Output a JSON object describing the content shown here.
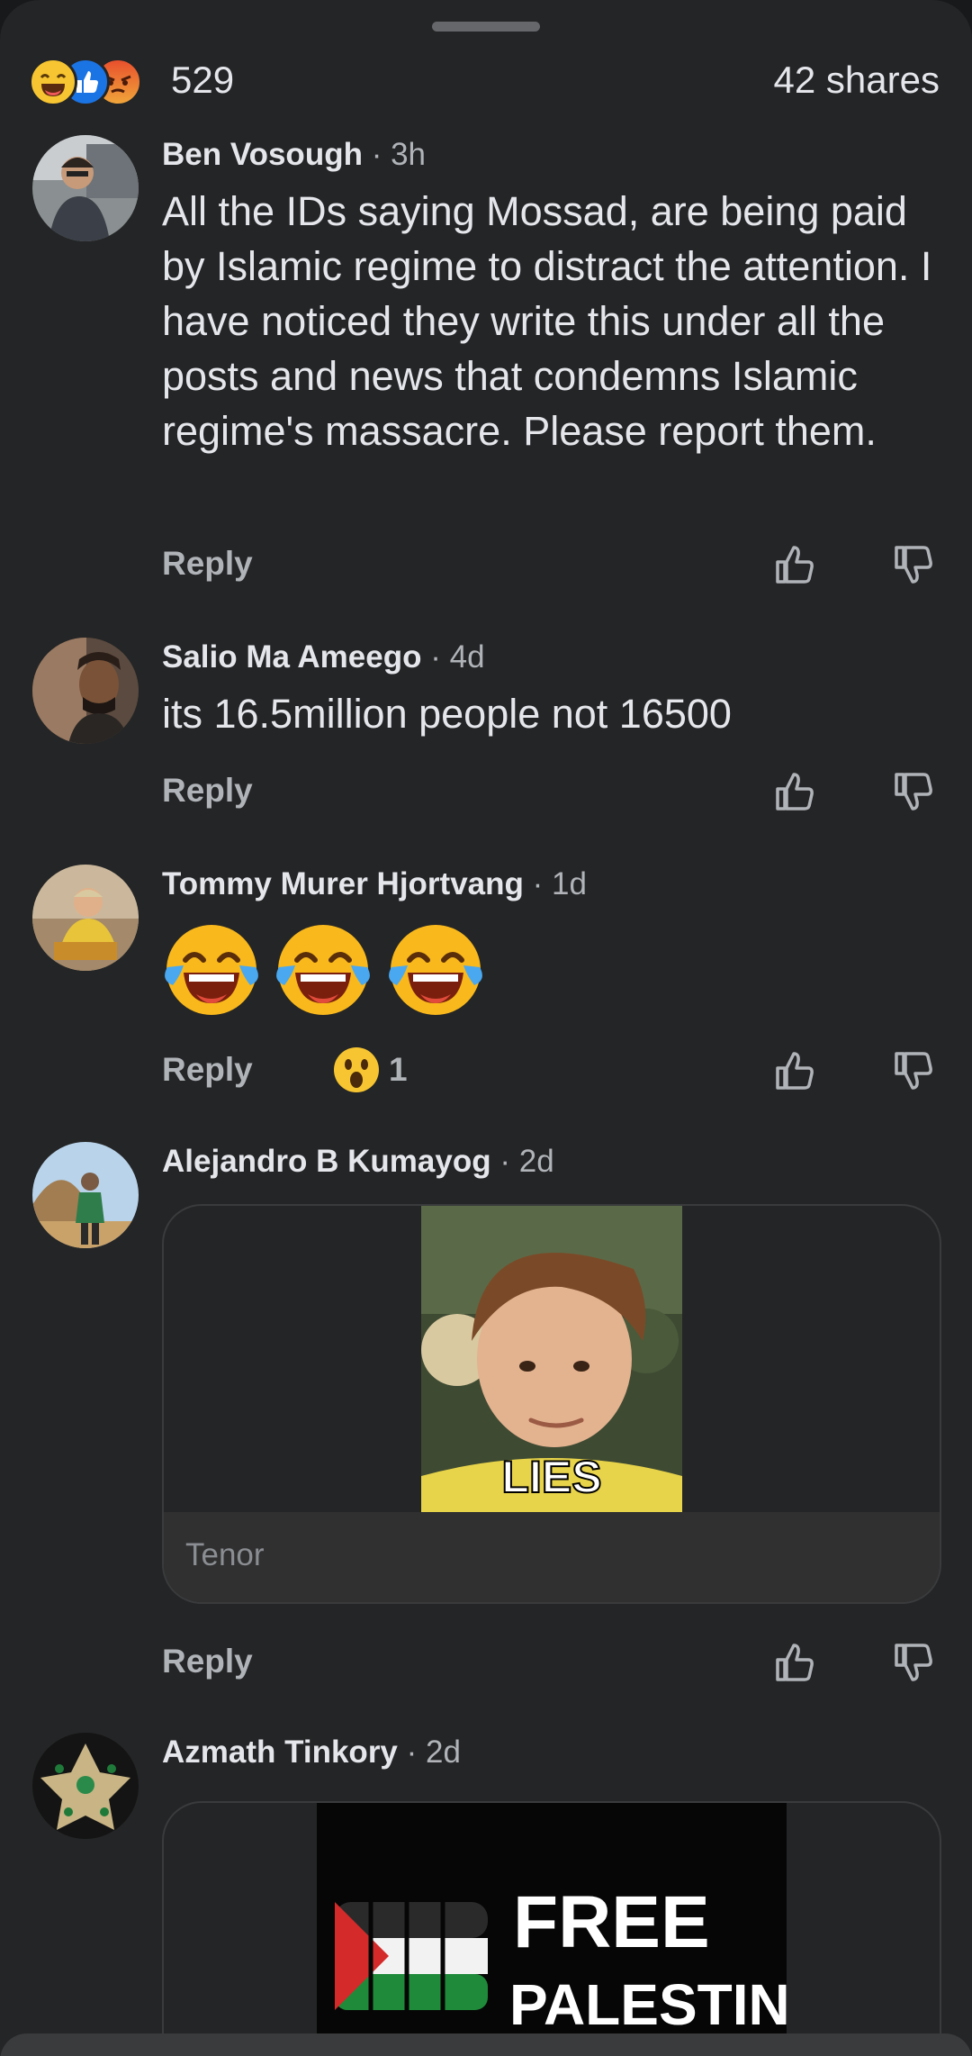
{
  "summary": {
    "reaction_icons": [
      "haha-reaction-icon",
      "like-reaction-icon",
      "angry-reaction-icon"
    ],
    "reaction_count": "529",
    "shares": "42 shares"
  },
  "comments": [
    {
      "author": "Ben Vosough",
      "separator": "·",
      "time": "3h",
      "text": "All the IDs saying Mossad, are being paid by Islamic regime to distract the attention. I have noticed they write this under all the posts and news that condemns Islamic regime's massacre. Please report them.",
      "reply": "Reply"
    },
    {
      "author": "Salio Ma Ameego",
      "separator": "·",
      "time": "4d",
      "text": "its 16.5million people not 16500",
      "reply": "Reply"
    },
    {
      "author": "Tommy Murer Hjortvang",
      "separator": "·",
      "time": "1d",
      "emojis": [
        "face-with-tears-of-joy",
        "face-with-tears-of-joy",
        "face-with-tears-of-joy"
      ],
      "reply": "Reply",
      "reaction": {
        "icon": "wow-reaction-icon",
        "count": "1"
      }
    },
    {
      "author": "Alejandro B Kumayog",
      "separator": "·",
      "time": "2d",
      "gif": {
        "caption": "LIES",
        "provider": "Tenor"
      },
      "reply": "Reply"
    },
    {
      "author": "Azmath Tinkory",
      "separator": "·",
      "time": "2d",
      "image": {
        "line1": "FREE",
        "line2": "PALESTINE"
      }
    }
  ],
  "colors": {
    "background": "#242526",
    "primary_text": "#e4e6eb",
    "secondary_text": "#b0b3b8",
    "like_blue": "#1b74e4",
    "haha_yellow": "#f7c531"
  }
}
